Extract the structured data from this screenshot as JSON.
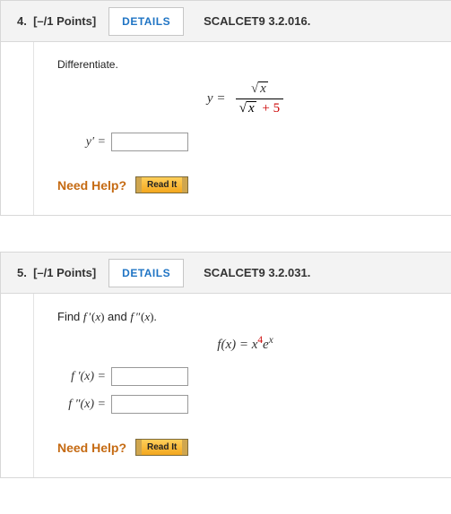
{
  "questions": [
    {
      "num_label": "4.",
      "points": "[–/1 Points]",
      "details_label": "DETAILS",
      "source": "SCALCET9 3.2.016.",
      "prompt": "Differentiate.",
      "display_prefix": "y  =",
      "sqrt_num_var": "x",
      "sqrt_den_var": "x",
      "den_extra": " + 5",
      "answer_label": "y′  =",
      "need_help": "Need Help?",
      "readit": "Read It"
    },
    {
      "num_label": "5.",
      "points": "[–/1 Points]",
      "details_label": "DETAILS",
      "source": "SCALCET9 3.2.031.",
      "prompt": "Find f ′(x) and f ″(x).",
      "fx_prefix": "f(x)  =  x",
      "fx_exp": "4",
      "fx_suffix1": "e",
      "fx_suffix2": "x",
      "fp_label": "f ′(x)   =",
      "fpp_label": "f ″(x)   =",
      "need_help": "Need Help?",
      "readit": "Read It"
    }
  ]
}
